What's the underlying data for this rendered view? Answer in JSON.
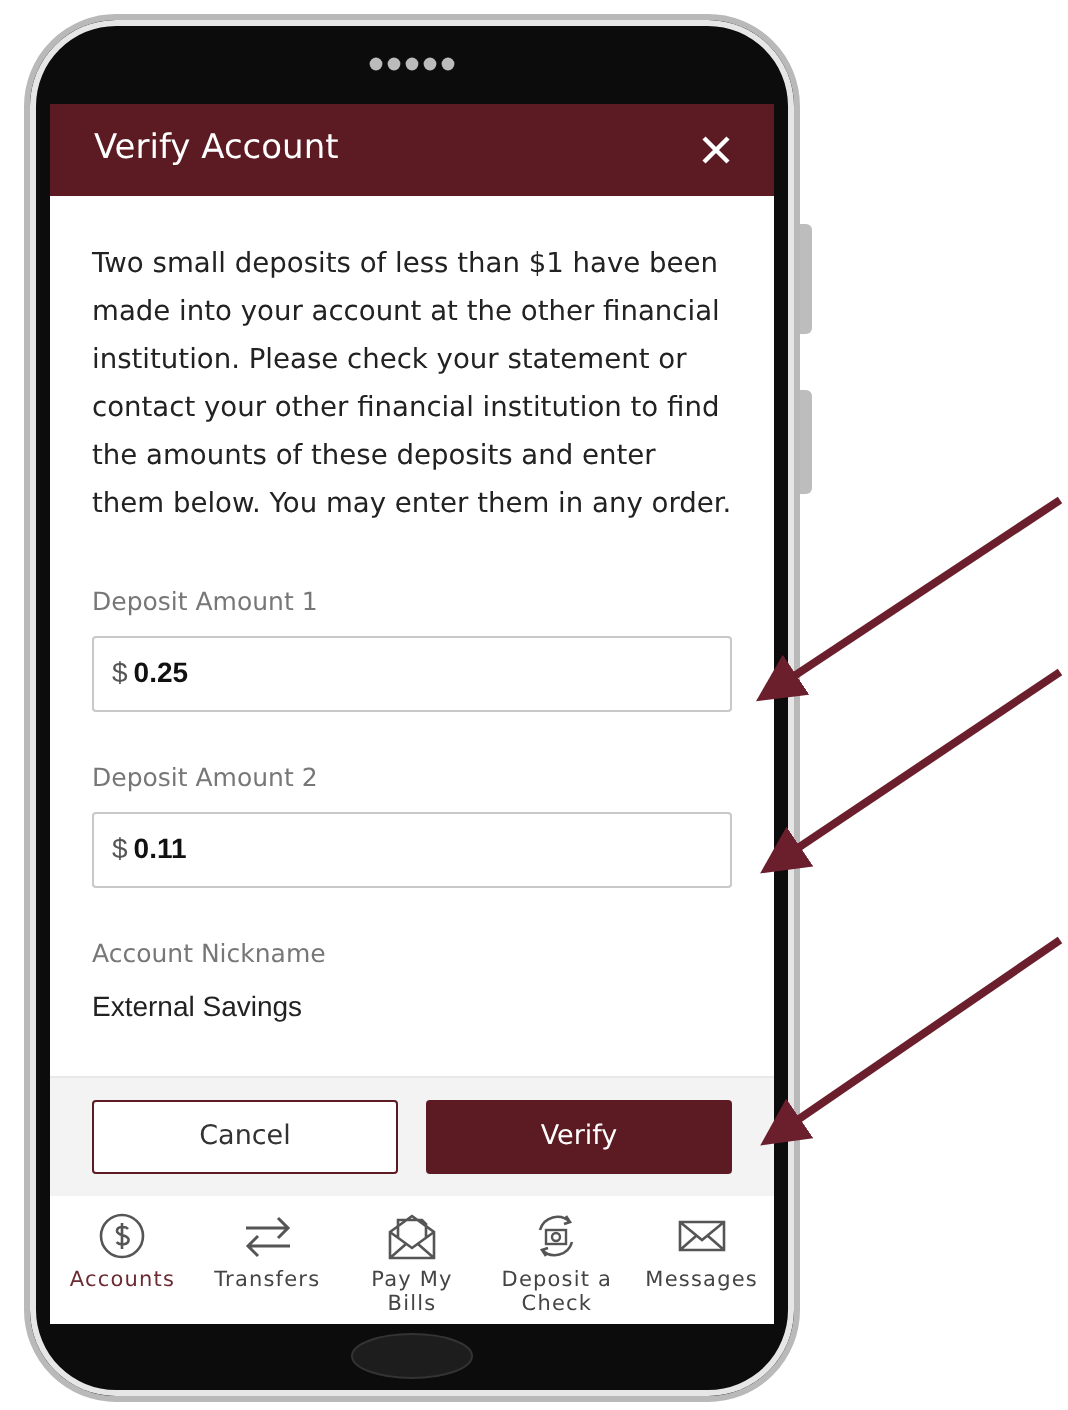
{
  "header": {
    "title": "Verify Account"
  },
  "intro": "Two small deposits of less than $1 have been made into your account at the other financial institution. Please check your statement or contact your other financial institution to find the amounts of these deposits and enter them below. You may enter them in any order.",
  "fields": [
    {
      "label": "Deposit Amount 1",
      "prefix": "$",
      "value": "0.25"
    },
    {
      "label": "Deposit Amount 2",
      "prefix": "$",
      "value": "0.11"
    }
  ],
  "nickname": {
    "label": "Account Nickname",
    "value": "External Savings"
  },
  "buttons": [
    {
      "label": "Cancel",
      "kind": "outline"
    },
    {
      "label": "Verify",
      "kind": "primary"
    }
  ],
  "tabs": [
    {
      "label": "Accounts",
      "kind": "dollar",
      "selected": true
    },
    {
      "label": "Transfers",
      "kind": "transfer",
      "selected": false
    },
    {
      "label": "Pay My Bills",
      "kind": "bill",
      "selected": false
    },
    {
      "label": "Deposit a Check",
      "kind": "camera",
      "selected": false
    },
    {
      "label": "Messages",
      "kind": "mail",
      "selected": false
    }
  ]
}
